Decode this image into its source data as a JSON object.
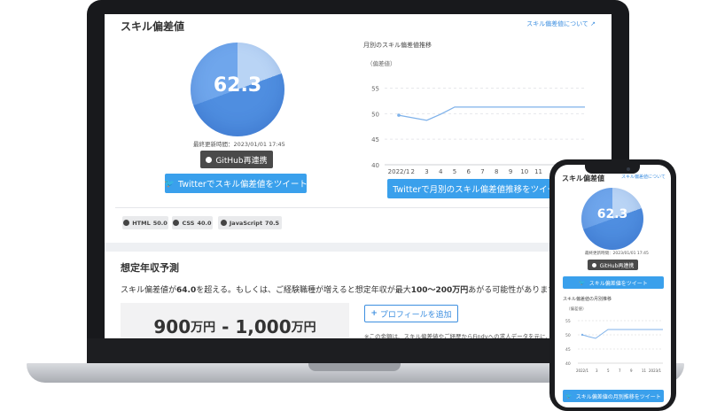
{
  "skill": {
    "title": "スキル偏差値",
    "about_link": "スキル偏差値について",
    "score": "62.3",
    "updated": "最終更新時間：2023/01/01 17:45",
    "github_button": "GitHub再連携",
    "tweet_button": "Twitterでスキル偏差値をツイート",
    "languages": [
      {
        "name": "HTML",
        "score": "50.0"
      },
      {
        "name": "CSS",
        "score": "40.0"
      },
      {
        "name": "JavaScript",
        "score": "70.5"
      }
    ]
  },
  "monthly": {
    "title": "月別のスキル偏差値推移",
    "unit": "（偏差値）",
    "tweet_button": "Twitterで月別のスキル偏差値推移をツイート"
  },
  "chart_data": {
    "type": "line",
    "title": "月別のスキル偏差値推移",
    "ylabel": "（偏差値）",
    "categories": [
      "2022/1",
      "2",
      "3",
      "4",
      "5",
      "6",
      "7",
      "8",
      "9",
      "10",
      "11"
    ],
    "values": [
      49.7,
      49.2,
      48.7,
      49.9,
      51.3,
      51.3,
      51.3,
      51.3,
      51.3,
      51.3,
      51.3
    ],
    "yticks": [
      40,
      45,
      50,
      55
    ],
    "ylim": [
      40,
      57
    ],
    "grid": true,
    "color": "#7fb2ea"
  },
  "income": {
    "title": "想定年収予測",
    "text_before": "スキル偏差値が",
    "threshold": "64.0",
    "text_middle": "を超える。もしくは、ご経験職種が増えると想定年収が最大",
    "range_up": "100〜200万円",
    "text_after": "あがる可能性があります。",
    "estimate_a": "900",
    "estimate_unit_a": "万円",
    "estimate_sep": " - ",
    "estimate_b": "1,000",
    "estimate_unit_b": "万円",
    "add_profile_button": "プロフィールを追加",
    "note": "※この金額は、スキル偏差値やご経歴からFindyへの求人データを元に、"
  },
  "phone": {
    "title": "スキル偏差値",
    "about_link": "スキル偏差値について",
    "score": "62.3",
    "updated": "最終更新時間：2023/01/01 17:45",
    "github_button": "GitHub再連携",
    "tweet_button": "スキル偏差値をツイート",
    "monthly_title": "スキル偏差値の月別推移",
    "unit": "（偏差値）",
    "x_labels": [
      "2022/1",
      "3",
      "5",
      "7",
      "9",
      "11",
      "2023/1"
    ],
    "yticks": [
      "55",
      "50",
      "45",
      "40"
    ],
    "monthly_tweet_button": "スキル偏差値の月別推移をツイート"
  },
  "colors": {
    "accent_blue": "#3aa0ec",
    "link_blue": "#3d8fe0",
    "dark_button": "#4a4a4a"
  }
}
